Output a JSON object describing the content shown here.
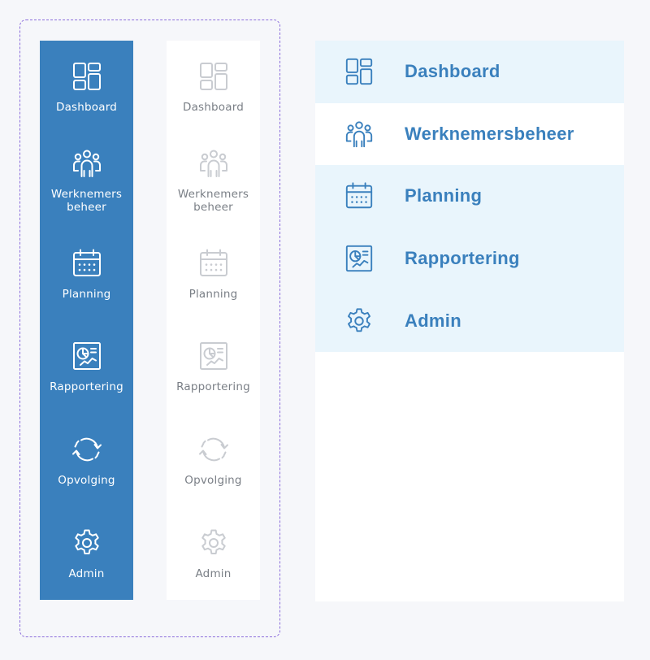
{
  "colors": {
    "accent": "#3a80bd",
    "highlight_bg": "#e9f5fc",
    "inactive_icon": "#c9ccd1",
    "inactive_text": "#7a7f86",
    "frame_border": "#8a6cdb",
    "page_bg": "#f6f7fa"
  },
  "sidebar_blue": {
    "items": [
      {
        "icon": "dashboard-icon",
        "label": "Dashboard"
      },
      {
        "icon": "users-icon",
        "label_line1": "Werknemers",
        "label_line2": "beheer"
      },
      {
        "icon": "calendar-icon",
        "label": "Planning"
      },
      {
        "icon": "report-icon",
        "label": "Rapportering"
      },
      {
        "icon": "refresh-icon",
        "label": "Opvolging"
      },
      {
        "icon": "gear-icon",
        "label": "Admin"
      }
    ]
  },
  "sidebar_white": {
    "items": [
      {
        "icon": "dashboard-icon",
        "label": "Dashboard"
      },
      {
        "icon": "users-icon",
        "label_line1": "Werknemers",
        "label_line2": "beheer"
      },
      {
        "icon": "calendar-icon",
        "label": "Planning"
      },
      {
        "icon": "report-icon",
        "label": "Rapportering"
      },
      {
        "icon": "refresh-icon",
        "label": "Opvolging"
      },
      {
        "icon": "gear-icon",
        "label": "Admin"
      }
    ]
  },
  "wide_menu": {
    "items": [
      {
        "icon": "dashboard-icon",
        "label": "Dashboard",
        "highlighted": true
      },
      {
        "icon": "users-icon",
        "label": "Werknemersbeheer",
        "highlighted": false
      },
      {
        "icon": "calendar-icon",
        "label": "Planning",
        "highlighted": true
      },
      {
        "icon": "report-icon",
        "label": "Rapportering",
        "highlighted": true
      },
      {
        "icon": "gear-icon",
        "label": "Admin",
        "highlighted": true
      }
    ]
  }
}
